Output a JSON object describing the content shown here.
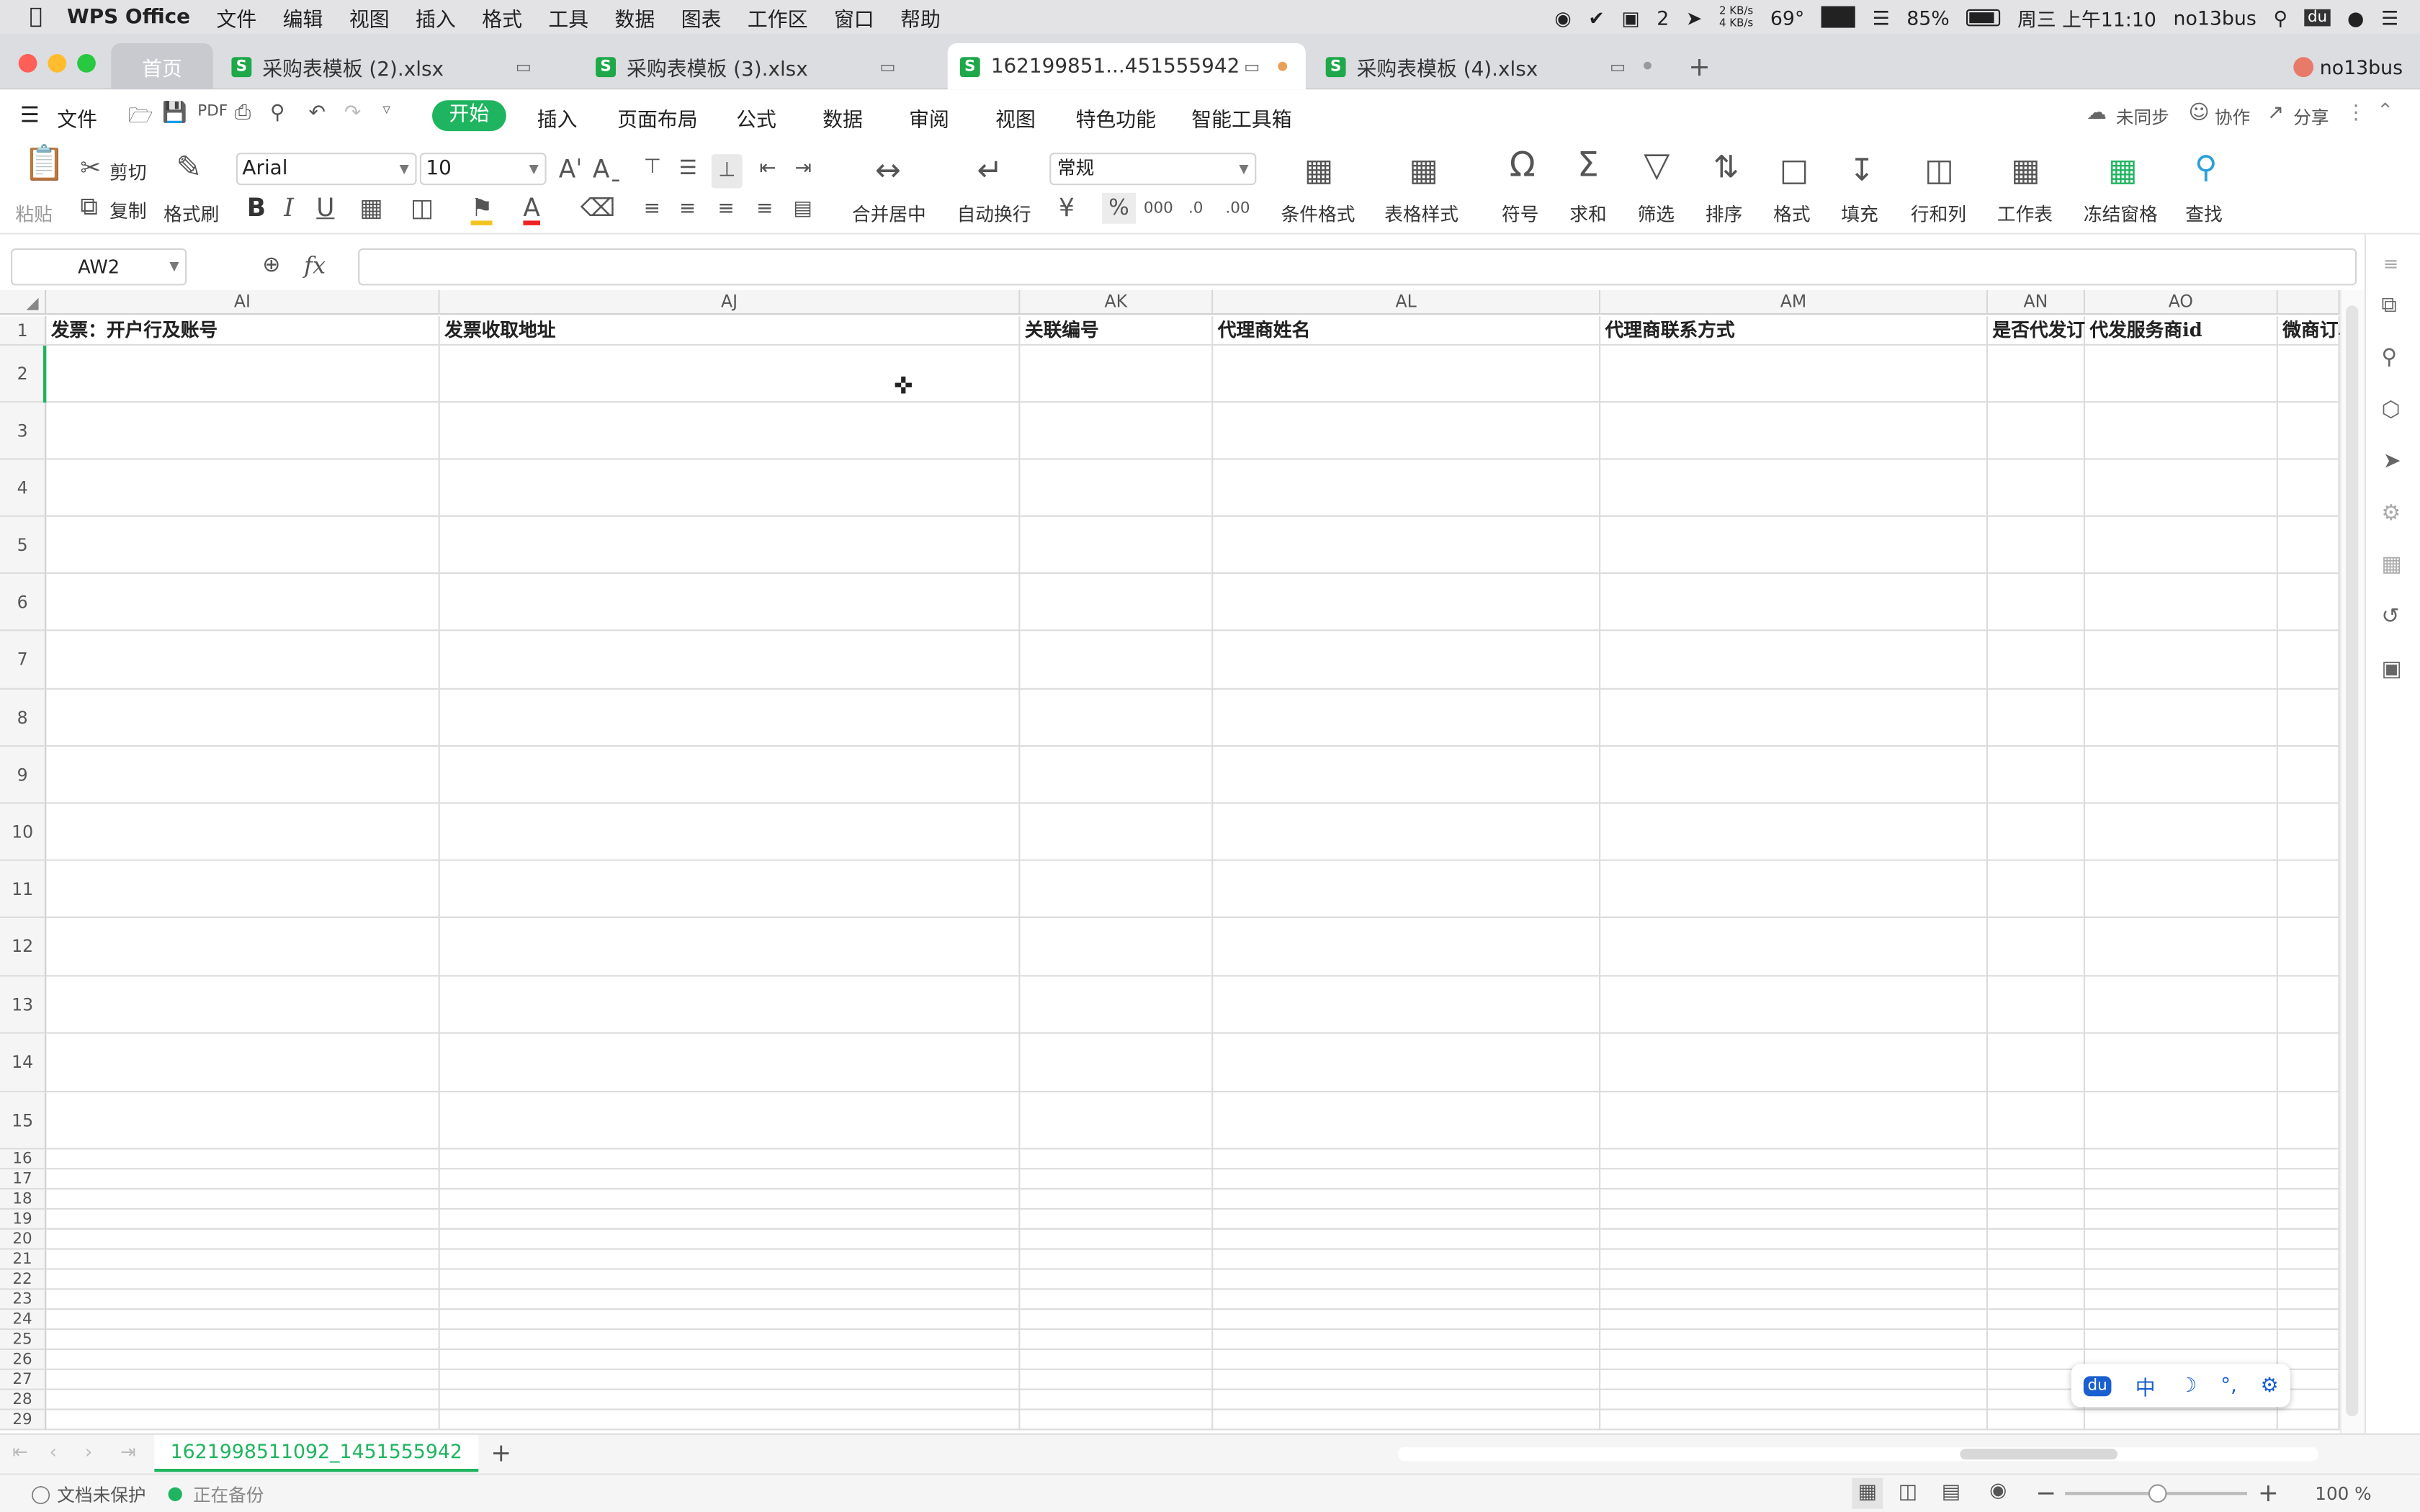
{
  "menubar": {
    "app_name": "WPS Office",
    "items": [
      "文件",
      "编辑",
      "视图",
      "插入",
      "格式",
      "工具",
      "数据",
      "图表",
      "工作区",
      "窗口",
      "帮助"
    ],
    "status": {
      "net_up": "2 KB/s",
      "net_down": "4 KB/s",
      "temp": "69°",
      "badge_count": "2",
      "battery": "85%",
      "datetime": "周三 上午11:10",
      "user": "no13bus"
    }
  },
  "tabs": {
    "home": "首页",
    "items": [
      {
        "label": "采购表模板 (2).xlsx"
      },
      {
        "label": "采购表模板 (3).xlsx"
      },
      {
        "label": "162199851...451555942"
      },
      {
        "label": "采购表模板 (4).xlsx"
      }
    ],
    "new_tab": "+",
    "account": "no13bus"
  },
  "toolbar": {
    "file": "文件",
    "menu_tabs": [
      "开始",
      "插入",
      "页面布局",
      "公式",
      "数据",
      "审阅",
      "视图",
      "特色功能",
      "智能工具箱"
    ],
    "unsync": "未同步",
    "collab": "协作",
    "share": "分享"
  },
  "ribbon": {
    "paste": "粘贴",
    "cut": "剪切",
    "copy": "复制",
    "format_painter": "格式刷",
    "font_name": "Arial",
    "font_size": "10",
    "merge": "合并居中",
    "wrap": "自动换行",
    "number_format": "常规",
    "cond_format": "条件格式",
    "table_style": "表格样式",
    "symbol": "符号",
    "sum": "求和",
    "filter": "筛选",
    "sort": "排序",
    "format": "格式",
    "fill": "填充",
    "rowcol": "行和列",
    "worksheet": "工作表",
    "freeze": "冻结窗格",
    "find": "查找"
  },
  "formula": {
    "cell_ref": "AW2",
    "fx": "fx",
    "value": ""
  },
  "columns": [
    {
      "name": "AI",
      "header": "发票：开户行及账号"
    },
    {
      "name": "AJ",
      "header": "发票收取地址"
    },
    {
      "name": "AK",
      "header": "关联编号"
    },
    {
      "name": "AL",
      "header": "代理商姓名"
    },
    {
      "name": "AM",
      "header": "代理商联系方式"
    },
    {
      "name": "AN",
      "header": "是否代发订单"
    },
    {
      "name": "AO",
      "header": "代发服务商id"
    },
    {
      "name": "",
      "header": "微商订单"
    }
  ],
  "rows": [
    "1",
    "2",
    "3",
    "4",
    "5",
    "6",
    "7",
    "8",
    "9",
    "10",
    "11",
    "12",
    "13",
    "14",
    "15",
    "16",
    "17",
    "18",
    "19",
    "20",
    "21",
    "22",
    "23",
    "24",
    "25",
    "26",
    "27",
    "28",
    "29"
  ],
  "sheet": {
    "name": "1621998511092_1451555942",
    "add": "+"
  },
  "status": {
    "protect": "文档未保护",
    "backup": "正在备份",
    "zoom": "100 %"
  },
  "ime": {
    "lang": "中"
  }
}
